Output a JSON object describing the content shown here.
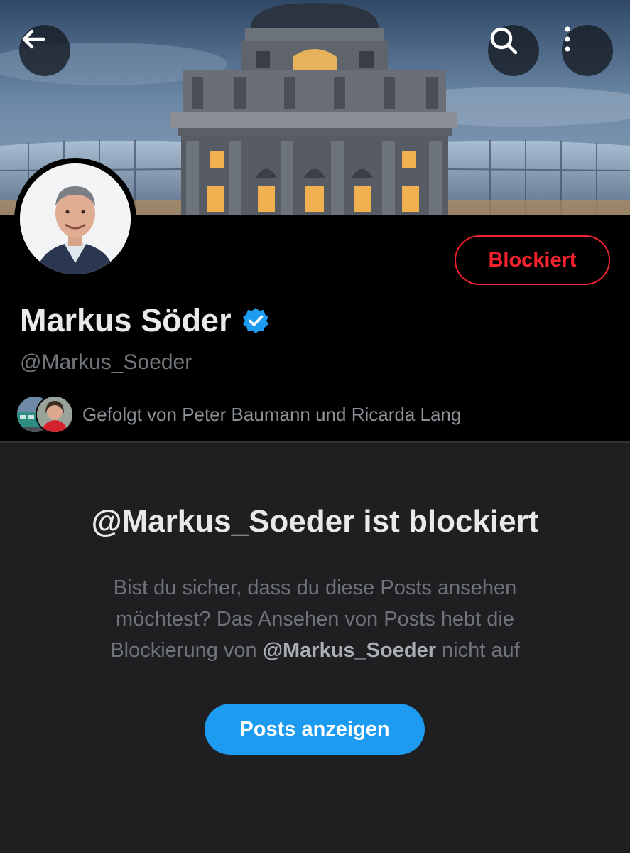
{
  "header": {
    "back_icon": "arrow-left-icon",
    "search_icon": "search-icon",
    "more_icon": "more-vertical-icon"
  },
  "profile": {
    "display_name": "Markus Söder",
    "verified_icon": "verified-badge-icon",
    "handle": "@Markus_Soeder",
    "block_status_label": "Blockiert",
    "followed_by": "Gefolgt von Peter Baumann und Ricarda Lang"
  },
  "blocked_notice": {
    "title": "@Markus_Soeder ist blockiert",
    "description_part1": "Bist du sicher, dass du diese Posts ansehen möchtest? Das Ansehen von Posts hebt die Blockierung von",
    "description_handle": "@Markus_Soeder",
    "description_part2": "nicht auf",
    "show_posts_label": "Posts anzeigen"
  },
  "colors": {
    "accent_blue": "#1d9bf0",
    "blocked_red": "#f4212e",
    "background": "#000000",
    "panel": "#1f1f22"
  }
}
